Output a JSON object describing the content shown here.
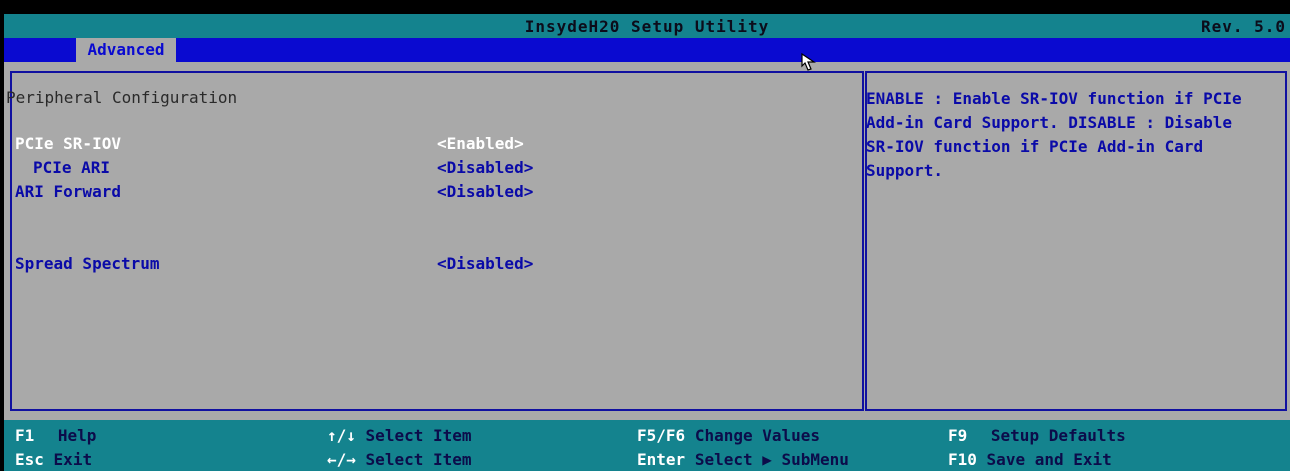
{
  "header": {
    "title": "InsydeH20 Setup Utility",
    "rev": "Rev. 5.0"
  },
  "tabs": [
    {
      "label": "Advanced",
      "active": true
    }
  ],
  "section": {
    "title": "Peripheral Configuration"
  },
  "settings": [
    {
      "label": "PCIe SR-IOV",
      "value": "<Enabled>",
      "highlighted": true
    },
    {
      "label": "PCIe ARI",
      "value": "<Disabled>",
      "highlighted": false
    },
    {
      "label": "ARI Forward",
      "value": "<Disabled>",
      "highlighted": false
    },
    {
      "label": "Spread Spectrum",
      "value": "<Disabled>",
      "highlighted": false
    }
  ],
  "help": {
    "lines": [
      "ENABLE : Enable SR-IOV function if PCIe",
      "Add-in Card Support.  DISABLE : Disable",
      "SR-IOV function if PCIe Add-in Card",
      "Support."
    ]
  },
  "footer": {
    "keys": [
      {
        "key": "F1",
        "desc": "Help"
      },
      {
        "key": "Esc",
        "desc": "Exit"
      },
      {
        "key": "↑/↓",
        "desc": "Select Item"
      },
      {
        "key": "←/→",
        "desc": "Select Item"
      },
      {
        "key": "F5/F6",
        "desc": "Change Values"
      },
      {
        "key": "Enter",
        "desc": "Select ▶ SubMenu"
      },
      {
        "key": "F9",
        "desc": "Setup Defaults"
      },
      {
        "key": "F10",
        "desc": "Save and Exit"
      }
    ]
  },
  "colors": {
    "title_bar": "#14838e",
    "tab_bar": "#0a0ad0",
    "content_bg": "#a9a9a9",
    "text_blue": "#0a0aa8",
    "highlight": "#ffffff"
  }
}
